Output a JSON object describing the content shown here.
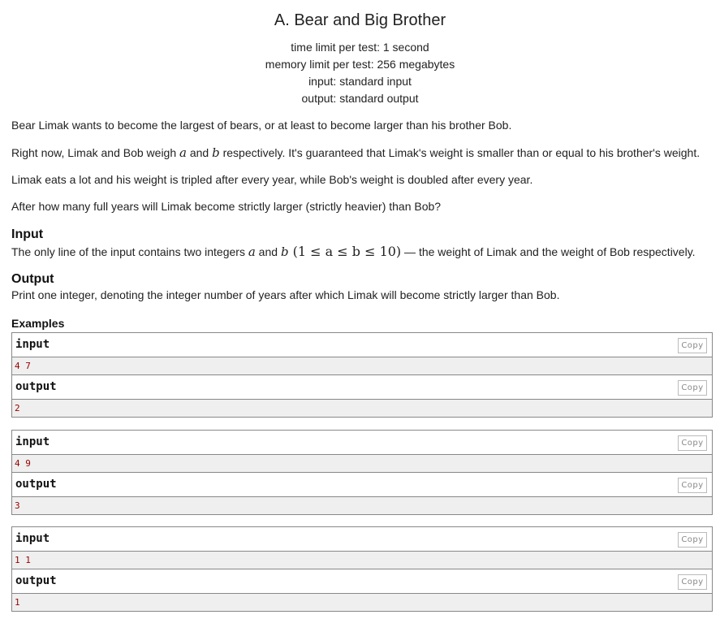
{
  "problem": {
    "title": "A. Bear and Big Brother",
    "limits": [
      "time limit per test: 1 second",
      "memory limit per test: 256 megabytes",
      "input: standard input",
      "output: standard output"
    ]
  },
  "statement": {
    "p1": "Bear Limak wants to become the largest of bears, or at least to become larger than his brother Bob.",
    "p2_a": "Right now, Limak and Bob weigh ",
    "p2_var_a": "a",
    "p2_b": " and ",
    "p2_var_b": "b",
    "p2_c": " respectively. It's guaranteed that Limak's weight is smaller than or equal to his brother's weight.",
    "p3": "Limak eats a lot and his weight is tripled after every year, while Bob's weight is doubled after every year.",
    "p4": "After how many full years will Limak become strictly larger (strictly heavier) than Bob?"
  },
  "input_section": {
    "title": "Input",
    "text_a": "The only line of the input contains two integers ",
    "var_a": "a",
    "text_b": " and ",
    "var_b": "b",
    "constraint": " (1 ≤ a ≤ b ≤ 10)",
    "text_c": " — the weight of Limak and the weight of Bob respectively."
  },
  "output_section": {
    "title": "Output",
    "text": "Print one integer, denoting the integer number of years after which Limak will become strictly larger than Bob."
  },
  "examples": {
    "title": "Examples",
    "input_label": "input",
    "output_label": "output",
    "copy_label": "Copy",
    "items": [
      {
        "input": "4 7",
        "output": "2"
      },
      {
        "input": "4 9",
        "output": "3"
      },
      {
        "input": "1 1",
        "output": "1"
      }
    ]
  }
}
